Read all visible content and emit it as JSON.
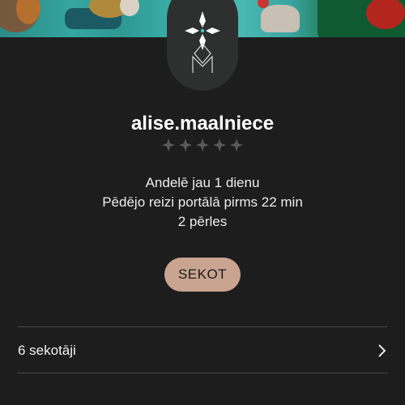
{
  "profile": {
    "username": "alise.maalniece",
    "rating_stars": 5,
    "selling_since": "Andelē jau 1 dienu",
    "last_seen": "Pēdējo reizi portālā pirms 22 min",
    "pearls": "2 pērles"
  },
  "actions": {
    "follow_label": "SEKOT"
  },
  "followers_row": {
    "label": "6 sekotāji"
  },
  "colors": {
    "background": "#1d1d1d",
    "avatar_bg": "#2e302f",
    "follow_button": "#c9a490",
    "divider": "#4a4a4a",
    "avatar_accent": "#3ec9c0"
  },
  "icons": {
    "avatar": "diamond-monogram-icon",
    "rating": "star-icon",
    "row_arrow": "chevron-right-icon"
  }
}
